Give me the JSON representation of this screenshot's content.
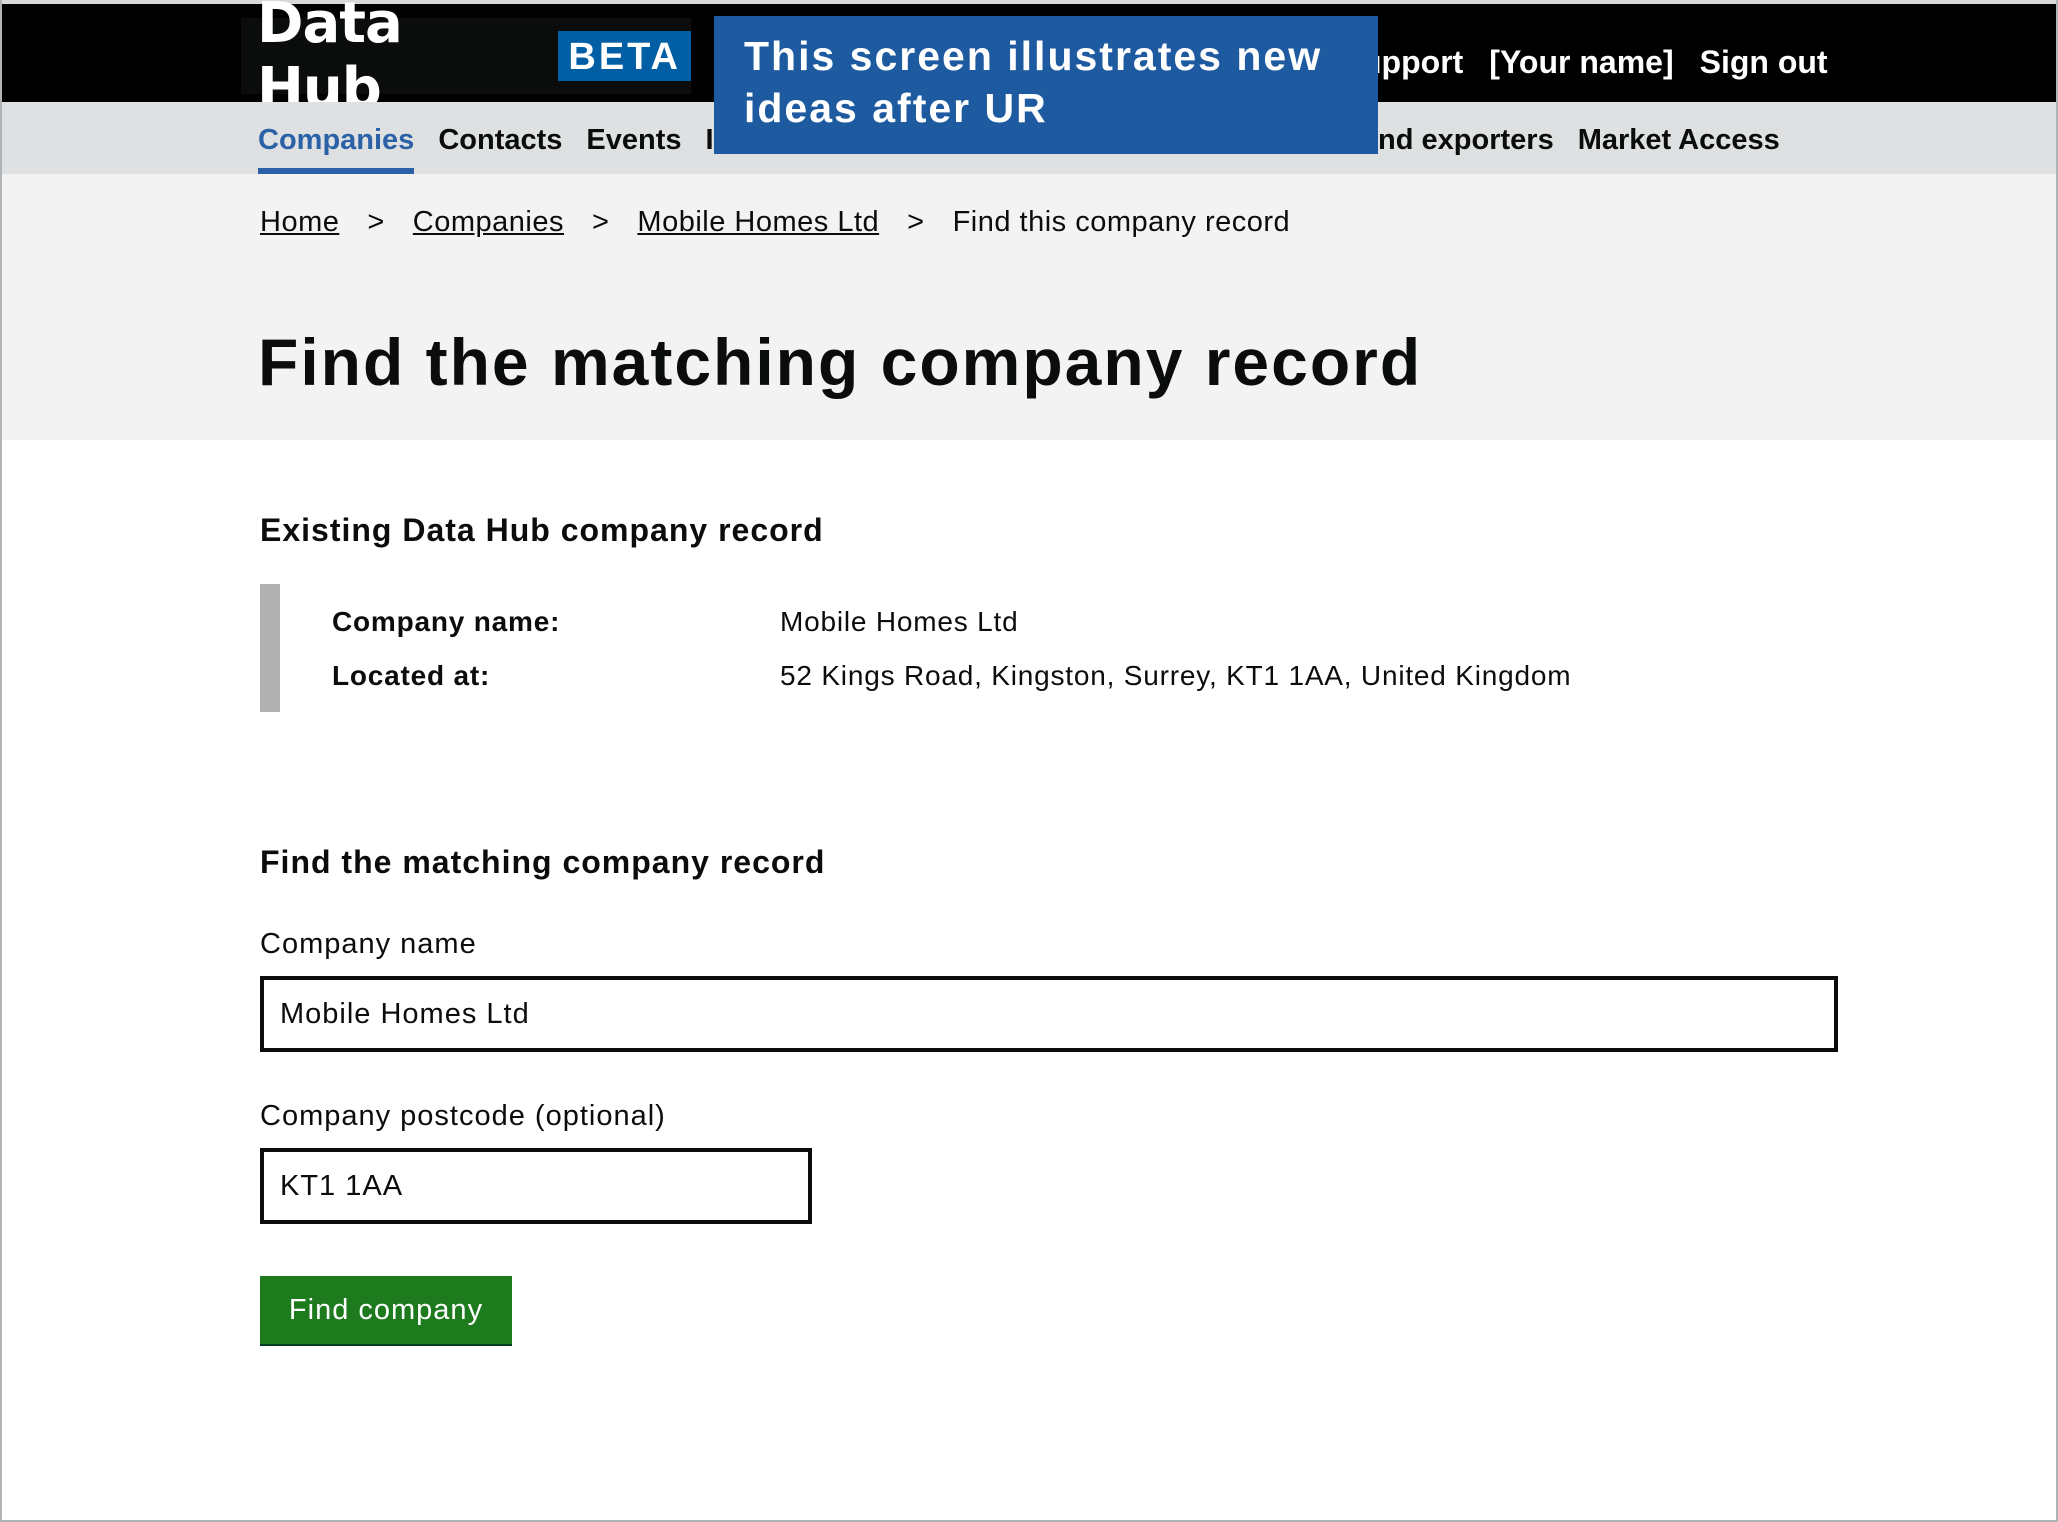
{
  "header": {
    "logo_text": "Data Hub",
    "beta_label": "BETA",
    "links": [
      "Support",
      "[Your name]",
      "Sign out"
    ],
    "support_visible": "upport"
  },
  "annotation": {
    "text": "This screen illustrates new ideas after UR"
  },
  "nav": {
    "items": [
      "Companies",
      "Contacts",
      "Events",
      "In"
    ],
    "items_right": [
      "ind exporters",
      "Market Access"
    ],
    "active": "Companies"
  },
  "breadcrumbs": {
    "home": "Home",
    "companies": "Companies",
    "company": "Mobile Homes Ltd",
    "current": "Find this company record",
    "separator": ">"
  },
  "page_title": "Find the matching company record",
  "existing": {
    "heading": "Existing Data Hub company record",
    "company_name_label": "Company name:",
    "company_name_value": "Mobile Homes Ltd",
    "located_at_label": "Located at:",
    "located_at_value": "52 Kings Road, Kingston, Surrey, KT1 1AA, United Kingdom"
  },
  "form": {
    "heading": "Find the matching company record",
    "company_name_label": "Company name",
    "company_name_value": "Mobile Homes Ltd",
    "postcode_label": "Company postcode (optional)",
    "postcode_value": "KT1 1AA",
    "submit_label": "Find company"
  }
}
